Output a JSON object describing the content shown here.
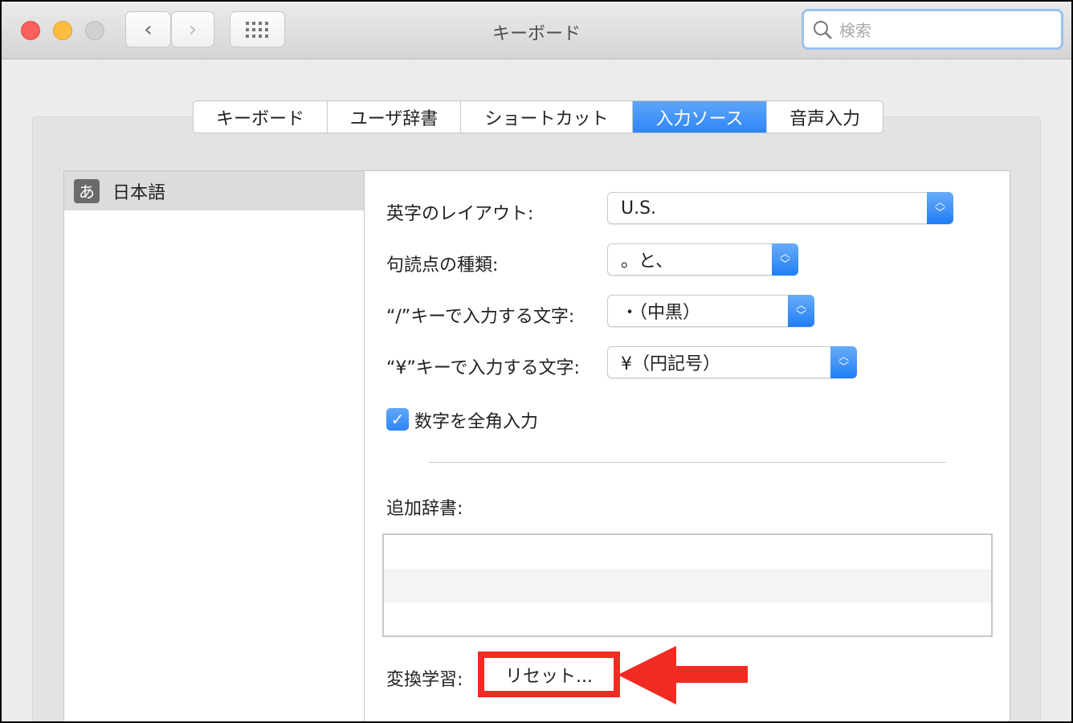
{
  "window": {
    "title": "キーボード",
    "search_placeholder": "検索"
  },
  "tabs": [
    {
      "label": "キーボード",
      "selected": false
    },
    {
      "label": "ユーザ辞書",
      "selected": false
    },
    {
      "label": "ショートカット",
      "selected": false
    },
    {
      "label": "入力ソース",
      "selected": true
    },
    {
      "label": "音声入力",
      "selected": false
    }
  ],
  "sources": [
    {
      "icon_text": "あ",
      "label": "日本語"
    }
  ],
  "settings": {
    "layout_label": "英字のレイアウト:",
    "layout_value": "U.S.",
    "punct_label": "句読点の種類:",
    "punct_value": "。と、",
    "slash_label": "“/”キーで入力する文字:",
    "slash_value": "・（中黒）",
    "yen_label": "“¥”キーで入力する文字:",
    "yen_value": "¥（円記号）",
    "fullwidth_label": "数字を全角入力",
    "fullwidth_checked": true,
    "dict_label": "追加辞書:",
    "learning_label": "変換学習:",
    "reset_label": "リセット..."
  },
  "colors": {
    "accent": "#2e86f6",
    "annotation": "#f22b22"
  }
}
